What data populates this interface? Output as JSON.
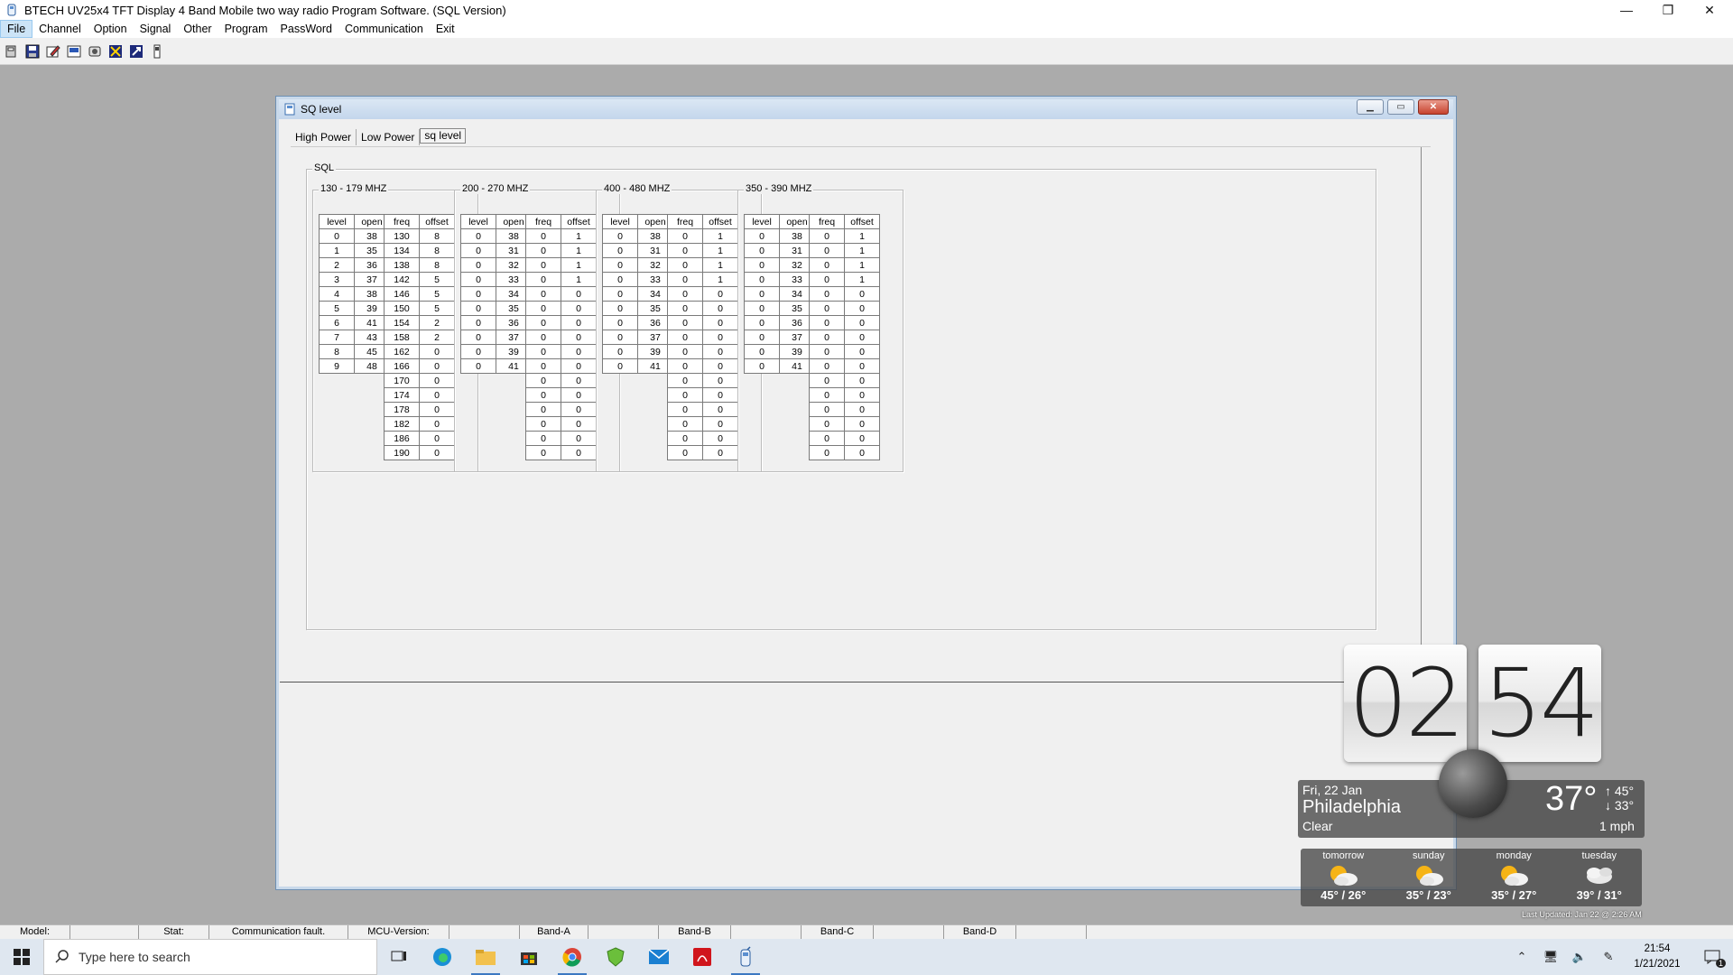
{
  "window": {
    "title": "BTECH  UV25x4 TFT Display 4 Band Mobile two way radio Program Software. (SQL Version)",
    "minimize": "—",
    "restore": "❐",
    "close": "✕"
  },
  "menu": [
    "File",
    "Channel",
    "Option",
    "Signal",
    "Other",
    "Program",
    "PassWord",
    "Communication",
    "Exit"
  ],
  "toolbar_icons": [
    "open-icon",
    "save-icon",
    "edit-icon",
    "read-icon",
    "write-icon",
    "radio-icon",
    "close-file-icon",
    "info-icon"
  ],
  "child": {
    "title": "SQ level",
    "tabs": [
      "High Power",
      "Low Power",
      "sq level"
    ],
    "selected_tab": "sq level",
    "group_label": "SQL",
    "bands": [
      {
        "label": "130 - 179 MHZ",
        "level_headers": [
          "level",
          "open"
        ],
        "level_rows": [
          [
            "0",
            "38"
          ],
          [
            "1",
            "35"
          ],
          [
            "2",
            "36"
          ],
          [
            "3",
            "37"
          ],
          [
            "4",
            "38"
          ],
          [
            "5",
            "39"
          ],
          [
            "6",
            "41"
          ],
          [
            "7",
            "43"
          ],
          [
            "8",
            "45"
          ],
          [
            "9",
            "48"
          ]
        ],
        "freq_headers": [
          "freq",
          "offset"
        ],
        "freq_rows": [
          [
            "130",
            "8"
          ],
          [
            "134",
            "8"
          ],
          [
            "138",
            "8"
          ],
          [
            "142",
            "5"
          ],
          [
            "146",
            "5"
          ],
          [
            "150",
            "5"
          ],
          [
            "154",
            "2"
          ],
          [
            "158",
            "2"
          ],
          [
            "162",
            "0"
          ],
          [
            "166",
            "0"
          ],
          [
            "170",
            "0"
          ],
          [
            "174",
            "0"
          ],
          [
            "178",
            "0"
          ],
          [
            "182",
            "0"
          ],
          [
            "186",
            "0"
          ],
          [
            "190",
            "0"
          ]
        ]
      },
      {
        "label": "200 - 270 MHZ",
        "level_headers": [
          "level",
          "open"
        ],
        "level_rows": [
          [
            "0",
            "38"
          ],
          [
            "0",
            "31"
          ],
          [
            "0",
            "32"
          ],
          [
            "0",
            "33"
          ],
          [
            "0",
            "34"
          ],
          [
            "0",
            "35"
          ],
          [
            "0",
            "36"
          ],
          [
            "0",
            "37"
          ],
          [
            "0",
            "39"
          ],
          [
            "0",
            "41"
          ]
        ],
        "freq_headers": [
          "freq",
          "offset"
        ],
        "freq_rows": [
          [
            "0",
            "1"
          ],
          [
            "0",
            "1"
          ],
          [
            "0",
            "1"
          ],
          [
            "0",
            "1"
          ],
          [
            "0",
            "0"
          ],
          [
            "0",
            "0"
          ],
          [
            "0",
            "0"
          ],
          [
            "0",
            "0"
          ],
          [
            "0",
            "0"
          ],
          [
            "0",
            "0"
          ],
          [
            "0",
            "0"
          ],
          [
            "0",
            "0"
          ],
          [
            "0",
            "0"
          ],
          [
            "0",
            "0"
          ],
          [
            "0",
            "0"
          ],
          [
            "0",
            "0"
          ]
        ]
      },
      {
        "label": "400 - 480 MHZ",
        "level_headers": [
          "level",
          "open"
        ],
        "level_rows": [
          [
            "0",
            "38"
          ],
          [
            "0",
            "31"
          ],
          [
            "0",
            "32"
          ],
          [
            "0",
            "33"
          ],
          [
            "0",
            "34"
          ],
          [
            "0",
            "35"
          ],
          [
            "0",
            "36"
          ],
          [
            "0",
            "37"
          ],
          [
            "0",
            "39"
          ],
          [
            "0",
            "41"
          ]
        ],
        "freq_headers": [
          "freq",
          "offset"
        ],
        "freq_rows": [
          [
            "0",
            "1"
          ],
          [
            "0",
            "1"
          ],
          [
            "0",
            "1"
          ],
          [
            "0",
            "1"
          ],
          [
            "0",
            "0"
          ],
          [
            "0",
            "0"
          ],
          [
            "0",
            "0"
          ],
          [
            "0",
            "0"
          ],
          [
            "0",
            "0"
          ],
          [
            "0",
            "0"
          ],
          [
            "0",
            "0"
          ],
          [
            "0",
            "0"
          ],
          [
            "0",
            "0"
          ],
          [
            "0",
            "0"
          ],
          [
            "0",
            "0"
          ],
          [
            "0",
            "0"
          ]
        ]
      },
      {
        "label": "350 - 390 MHZ",
        "level_headers": [
          "level",
          "open"
        ],
        "level_rows": [
          [
            "0",
            "38"
          ],
          [
            "0",
            "31"
          ],
          [
            "0",
            "32"
          ],
          [
            "0",
            "33"
          ],
          [
            "0",
            "34"
          ],
          [
            "0",
            "35"
          ],
          [
            "0",
            "36"
          ],
          [
            "0",
            "37"
          ],
          [
            "0",
            "39"
          ],
          [
            "0",
            "41"
          ]
        ],
        "freq_headers": [
          "freq",
          "offset"
        ],
        "freq_rows": [
          [
            "0",
            "1"
          ],
          [
            "0",
            "1"
          ],
          [
            "0",
            "1"
          ],
          [
            "0",
            "1"
          ],
          [
            "0",
            "0"
          ],
          [
            "0",
            "0"
          ],
          [
            "0",
            "0"
          ],
          [
            "0",
            "0"
          ],
          [
            "0",
            "0"
          ],
          [
            "0",
            "0"
          ],
          [
            "0",
            "0"
          ],
          [
            "0",
            "0"
          ],
          [
            "0",
            "0"
          ],
          [
            "0",
            "0"
          ],
          [
            "0",
            "0"
          ],
          [
            "0",
            "0"
          ]
        ]
      }
    ]
  },
  "statusbar": [
    {
      "text": "Model:"
    },
    {
      "text": ""
    },
    {
      "text": "Stat:"
    },
    {
      "text": "Communication fault."
    },
    {
      "text": "MCU-Version:"
    },
    {
      "text": ""
    },
    {
      "text": "Band-A"
    },
    {
      "text": ""
    },
    {
      "text": "Band-B"
    },
    {
      "text": ""
    },
    {
      "text": "Band-C"
    },
    {
      "text": ""
    },
    {
      "text": "Band-D"
    },
    {
      "text": ""
    }
  ],
  "taskbar": {
    "search_placeholder": "Type here to search",
    "apps": [
      "task-view-icon",
      "edge-icon",
      "file-explorer-icon",
      "store-icon",
      "chrome-icon",
      "vpn-shield-icon",
      "mail-icon",
      "acrobat-icon",
      "radio-program-icon"
    ],
    "time": "21:54",
    "date": "1/21/2021",
    "notification_count": "1"
  },
  "weather": {
    "hour": "02",
    "minute": "54",
    "date": "Fri, 22 Jan",
    "city": "Philadelphia",
    "condition": "Clear",
    "temp": "37°",
    "high": "↑ 45°",
    "low": "↓ 33°",
    "wind": "1 mph",
    "forecast": [
      {
        "day": "tomorrow",
        "temps": "45° / 26°",
        "icon": "sun-cloud-icon"
      },
      {
        "day": "sunday",
        "temps": "35° / 23°",
        "icon": "sun-cloud-icon"
      },
      {
        "day": "monday",
        "temps": "35° / 27°",
        "icon": "sun-cloud-icon"
      },
      {
        "day": "tuesday",
        "temps": "39° / 31°",
        "icon": "cloud-icon"
      }
    ],
    "last_updated": "Last Updated: Jan 22 @ 2:26 AM"
  }
}
